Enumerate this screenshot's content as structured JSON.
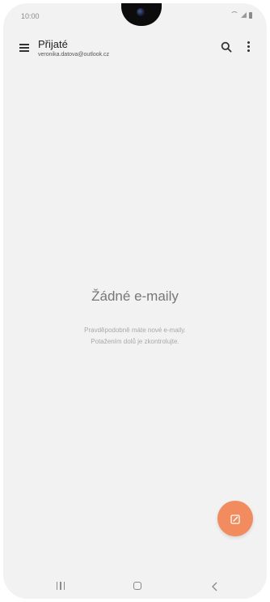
{
  "status_bar": {
    "time": "10:00"
  },
  "header": {
    "title": "Přijaté",
    "account": "veronika.datova@outlook.cz"
  },
  "empty_state": {
    "title": "Žádné e-maily",
    "hint_line1": "Pravděpodobně máte nové e-maily.",
    "hint_line2": "Potažením dolů je zkontrolujte."
  },
  "colors": {
    "background": "#f2f2f2",
    "compose_button": "#f28c5e"
  },
  "icons": {
    "menu": "hamburger-menu-icon",
    "search": "search-icon",
    "more": "more-vertical-icon",
    "compose": "compose-icon",
    "nav_recent": "recent-apps-icon",
    "nav_home": "home-icon",
    "nav_back": "back-icon"
  }
}
